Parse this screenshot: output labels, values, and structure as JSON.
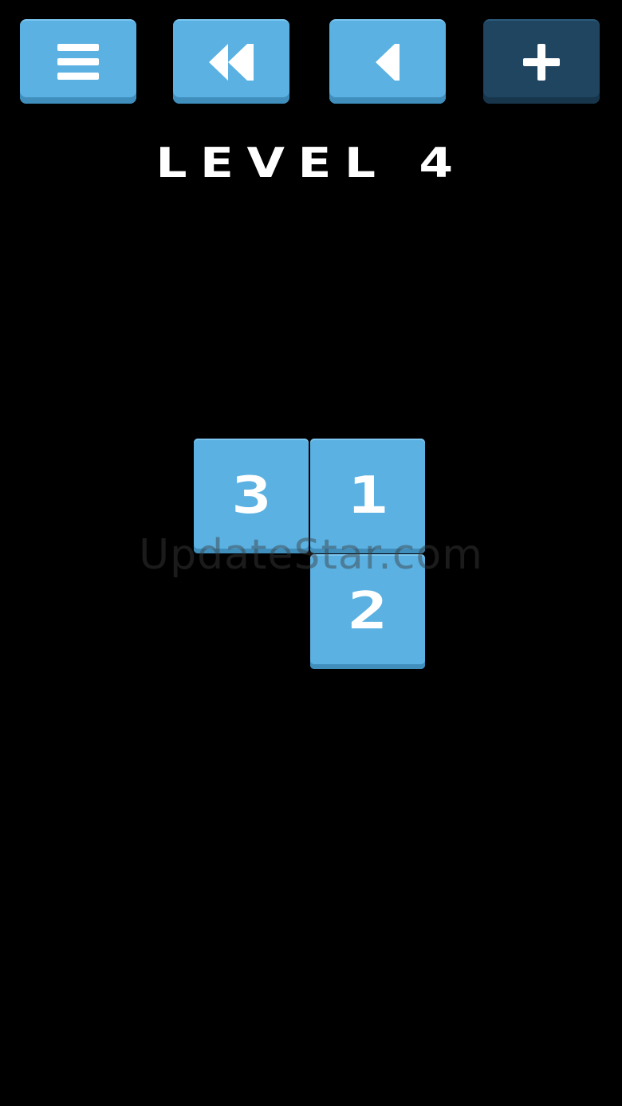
{
  "toolbar": {
    "buttons": [
      {
        "id": "menu",
        "icon": "menu-icon",
        "state": "active"
      },
      {
        "id": "restart",
        "icon": "rewind-icon",
        "state": "active"
      },
      {
        "id": "undo",
        "icon": "back-triangle-icon",
        "state": "active"
      },
      {
        "id": "add",
        "icon": "plus-icon",
        "state": "disabled"
      }
    ]
  },
  "level_title": "LEVEL 4",
  "tiles": [
    {
      "value": "3"
    },
    {
      "value": "1"
    },
    {
      "value": "2"
    }
  ],
  "watermark": "UpdateStar.com",
  "colors": {
    "background": "#000000",
    "tile": "#5ab1e2",
    "button_active": "#5ab1e2",
    "button_disabled": "#1f4560",
    "text": "#ffffff"
  }
}
